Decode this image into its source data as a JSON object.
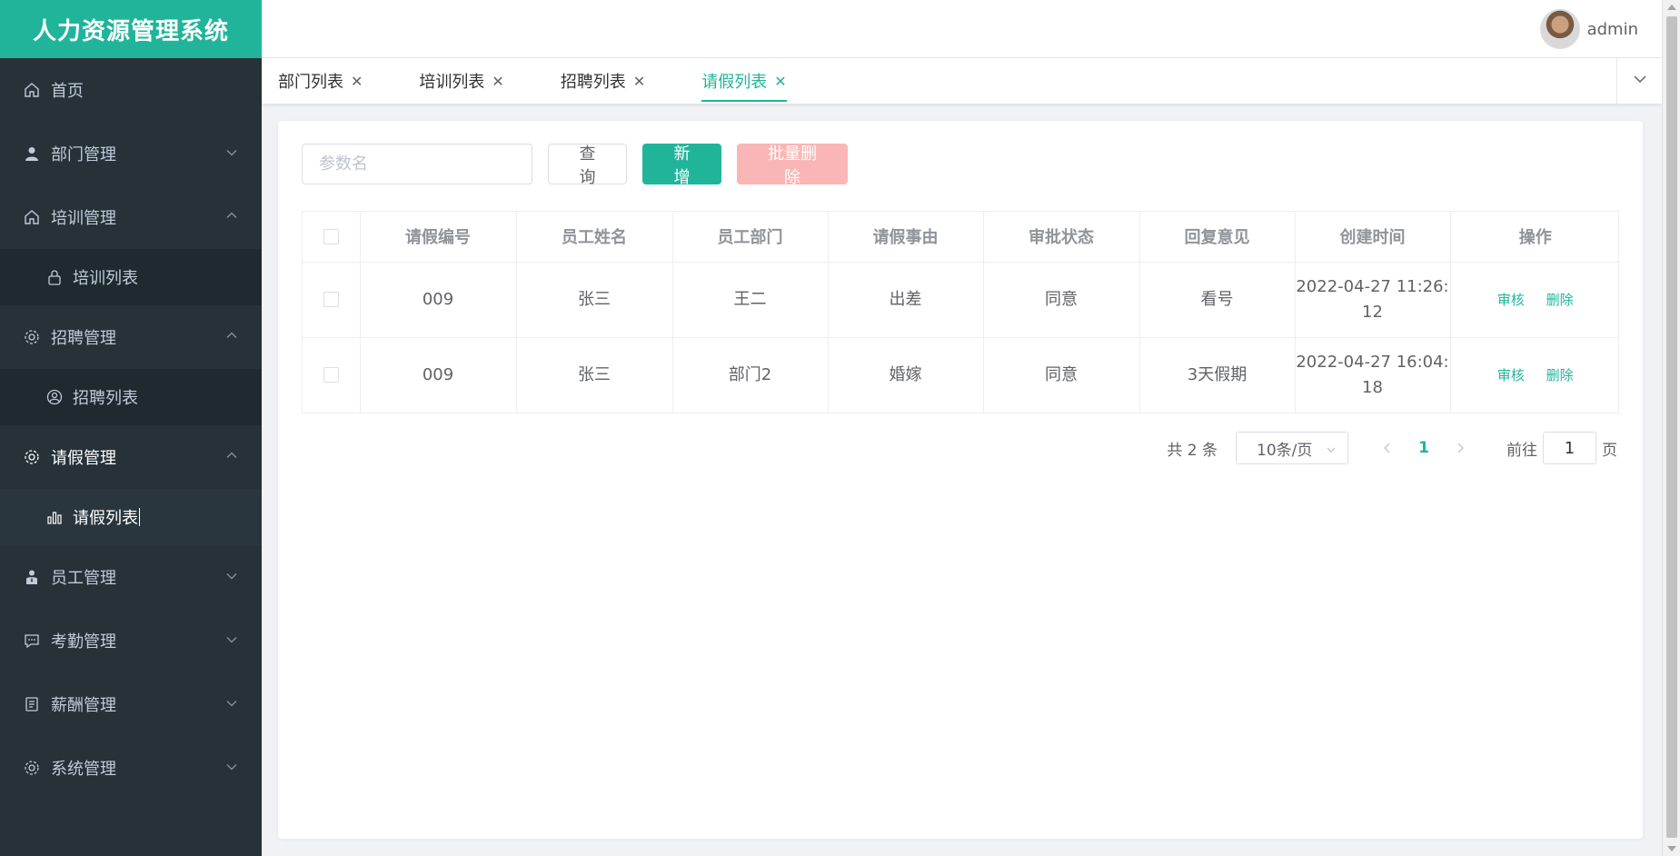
{
  "app": {
    "title": "人力资源管理系统"
  },
  "user": {
    "name": "admin"
  },
  "sidebar": {
    "items": [
      {
        "label": "首页",
        "icon": "home-icon"
      },
      {
        "label": "部门管理",
        "icon": "user-icon"
      },
      {
        "label": "培训管理",
        "icon": "home-icon"
      },
      {
        "label": "培训列表",
        "icon": "lock-icon"
      },
      {
        "label": "招聘管理",
        "icon": "gear-icon"
      },
      {
        "label": "招聘列表",
        "icon": "person-circle-icon"
      },
      {
        "label": "请假管理",
        "icon": "gear-icon"
      },
      {
        "label": "请假列表",
        "icon": "bar-chart-icon"
      },
      {
        "label": "员工管理",
        "icon": "person-icon"
      },
      {
        "label": "考勤管理",
        "icon": "chat-icon"
      },
      {
        "label": "薪酬管理",
        "icon": "document-icon"
      },
      {
        "label": "系统管理",
        "icon": "gear-icon"
      }
    ]
  },
  "tabs": [
    {
      "label": "部门列表"
    },
    {
      "label": "培训列表"
    },
    {
      "label": "招聘列表"
    },
    {
      "label": "请假列表"
    }
  ],
  "toolbar": {
    "search_placeholder": "参数名",
    "query_label": "查询",
    "add_label": "新增",
    "batch_delete_label": "批量删除"
  },
  "table": {
    "headers": [
      "请假编号",
      "员工姓名",
      "员工部门",
      "请假事由",
      "审批状态",
      "回复意见",
      "创建时间",
      "操作"
    ],
    "rows": [
      {
        "id": "009",
        "name": "张三",
        "dept": "王二",
        "reason": "出差",
        "status": "同意",
        "reply": "看号",
        "created_1": "2022-04-27 11:26:",
        "created_2": "12"
      },
      {
        "id": "009",
        "name": "张三",
        "dept": "部门2",
        "reason": "婚嫁",
        "status": "同意",
        "reply": "3天假期",
        "created_1": "2022-04-27 16:04:",
        "created_2": "18"
      }
    ],
    "actions": {
      "review": "审核",
      "delete": "删除"
    }
  },
  "pagination": {
    "total": "共 2 条",
    "page_size": "10条/页",
    "current_page": "1",
    "goto_prefix": "前往",
    "goto_value": "1",
    "goto_suffix": "页"
  },
  "colors": {
    "accent": "#20b59b",
    "sidebar_bg": "#263238",
    "danger_disabled": "#fab6b6"
  }
}
